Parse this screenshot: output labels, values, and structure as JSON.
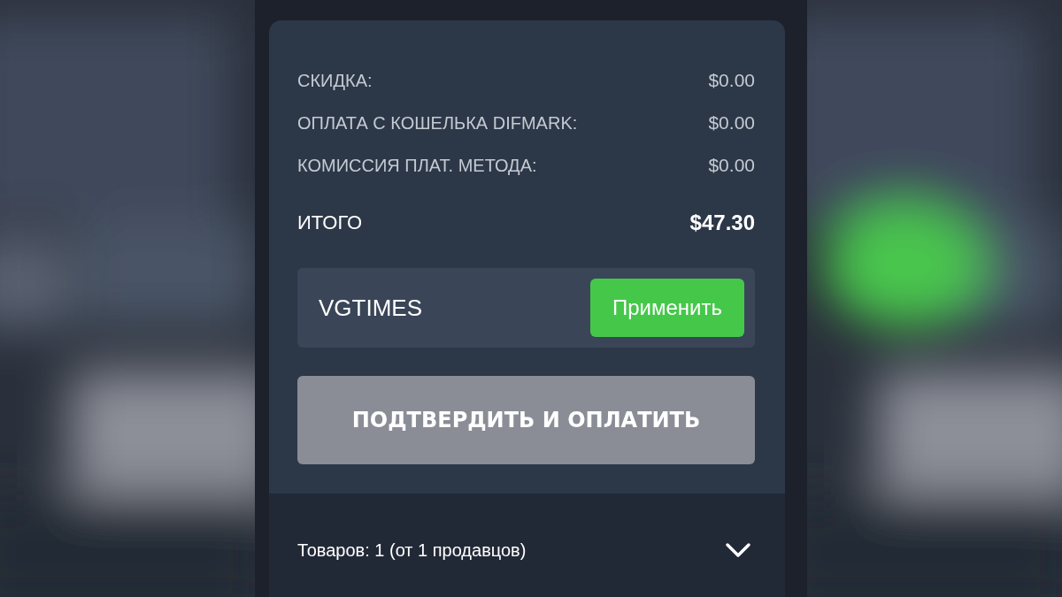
{
  "summary_rows": [
    {
      "label": "СКИДКА:",
      "value": "$0.00"
    },
    {
      "label": "ОПЛАТА С КОШЕЛЬКА DIFMARK:",
      "value": "$0.00"
    },
    {
      "label": "КОМИССИЯ ПЛАТ. МЕТОДА:",
      "value": "$0.00"
    }
  ],
  "total": {
    "label": "ИТОГО",
    "value": "$47.30"
  },
  "promo": {
    "value": "VGTIMES",
    "button": "Применить"
  },
  "pay_button": {
    "label": "ПОДТВЕРДИТЬ И ОПЛАТИТЬ",
    "disabled": true
  },
  "items_summary": {
    "text": "Товаров: 1 (от 1 продавцов)",
    "expanded": false
  }
}
